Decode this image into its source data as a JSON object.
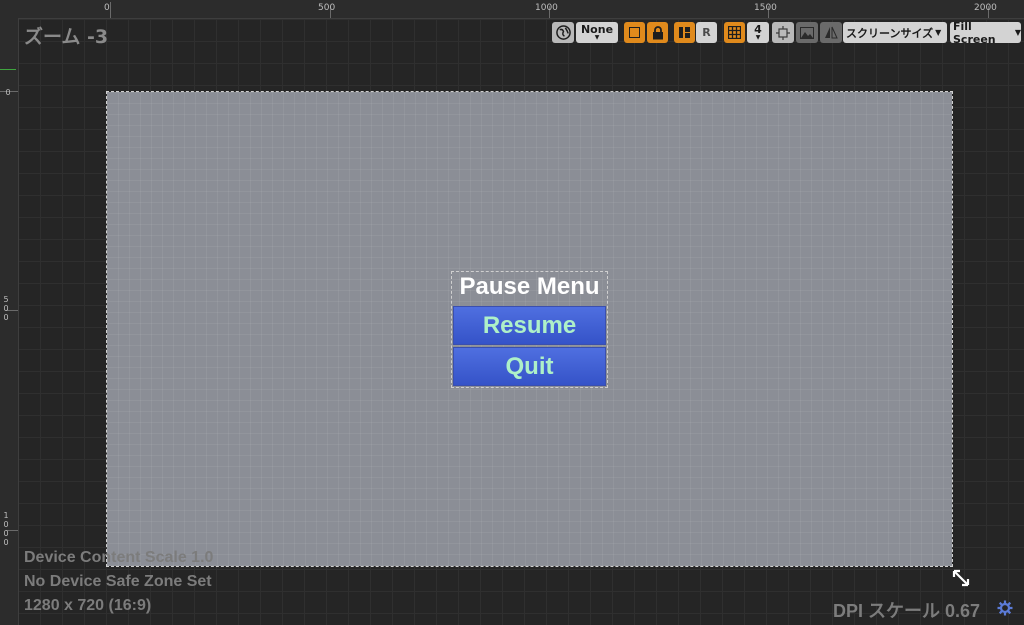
{
  "viewport": {
    "zoom_label": "ズーム -3",
    "ruler_top_labels": [
      "0",
      "500",
      "1000",
      "1500",
      "2000"
    ],
    "ruler_left_labels": [
      "0",
      "500",
      "1000"
    ]
  },
  "toolbar": {
    "world_icon": "globe-icon",
    "none_label": "None",
    "r_label": "R",
    "grid_value": "4",
    "screen_size_label": "スクリーンサイズ",
    "fill_screen_label": "Fill Screen"
  },
  "widget": {
    "title": "Pause Menu",
    "resume_label": "Resume",
    "quit_label": "Quit"
  },
  "status": {
    "device_content_scale": "Device Content Scale 1.0",
    "safe_zone": "No Device Safe Zone Set",
    "resolution": "1280 x 720 (16:9)",
    "dpi_scale": "DPI スケール 0.67"
  },
  "colors": {
    "accent_orange": "#e08a1c",
    "button_blue": "#4565d6",
    "button_text": "#aef0c8",
    "surface": "#8b8e96"
  }
}
